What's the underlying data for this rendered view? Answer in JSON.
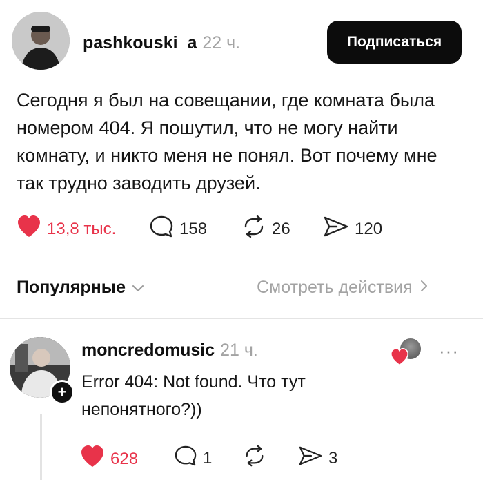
{
  "post": {
    "username": "pashkouski_a",
    "time": "22 ч.",
    "follow_label": "Подписаться",
    "text": "Сегодня я был на совещании, где комната была номером 404. Я пошутил, что не могу найти комнату, и никто меня не понял. Вот почему мне так трудно заводить друзей.",
    "likes": "13,8 тыс.",
    "comments": "158",
    "reposts": "26",
    "shares": "120"
  },
  "section": {
    "title": "Популярные",
    "link": "Смотреть действия"
  },
  "comment": {
    "username": "moncredomusic",
    "time": "21 ч.",
    "text": "Error 404: Not found. Что тут непонятного?))",
    "likes": "628",
    "comments": "1",
    "shares": "3",
    "more": "···"
  },
  "colors": {
    "accent": "#e8334a",
    "button_bg": "#0c0c0c",
    "muted": "#a3a3a3"
  },
  "icons": [
    "heart-icon",
    "comment-icon",
    "repost-icon",
    "share-icon",
    "chevron-down-icon",
    "chevron-right-icon",
    "plus-icon",
    "more-icon"
  ]
}
